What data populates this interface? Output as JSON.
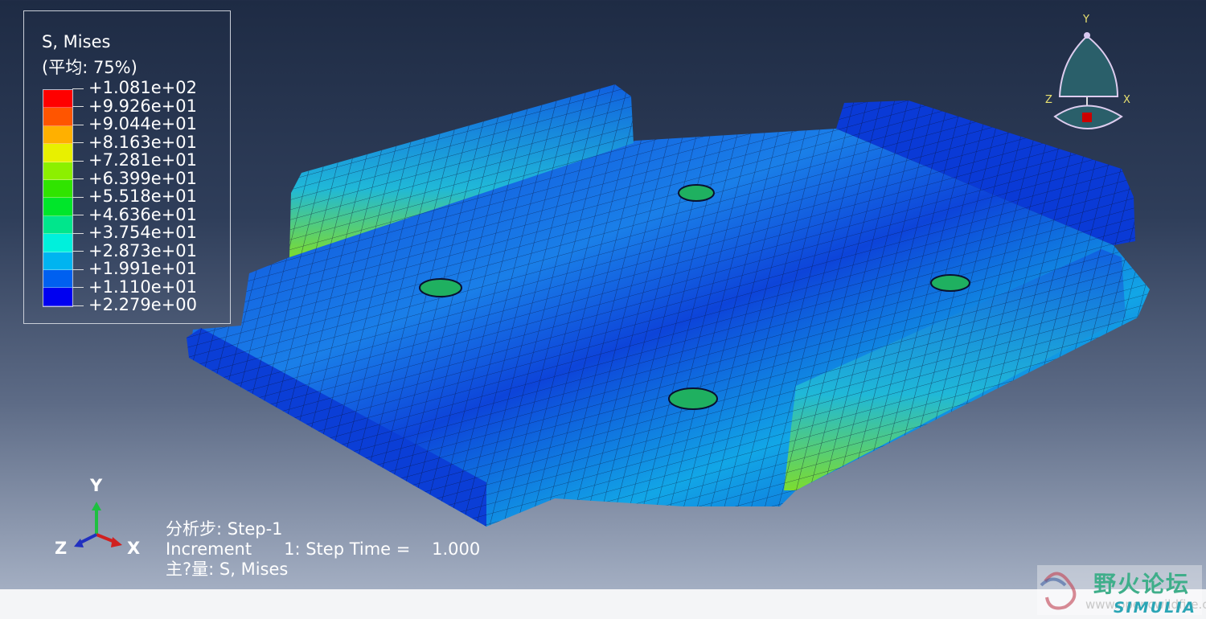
{
  "legend": {
    "title": "S, Mises",
    "subtitle": "(平均: 75%)",
    "labels": [
      "+1.081e+02",
      "+9.926e+01",
      "+9.044e+01",
      "+8.163e+01",
      "+7.281e+01",
      "+6.399e+01",
      "+5.518e+01",
      "+4.636e+01",
      "+3.754e+01",
      "+2.873e+01",
      "+1.991e+01",
      "+1.110e+01",
      "+2.279e+00"
    ],
    "band_colors": [
      "#ff0000",
      "#ff5500",
      "#ffb000",
      "#e8f000",
      "#8cf000",
      "#30e400",
      "#00e62a",
      "#00e68c",
      "#00f0dc",
      "#00b4f0",
      "#0060f0",
      "#0000f0"
    ]
  },
  "step_info": {
    "line1": "分析步: Step-1",
    "line2": "Increment      1: Step Time =    1.000",
    "line3": "主?量: S, Mises"
  },
  "triad": {
    "y": "Y",
    "z": "Z",
    "x": "X"
  },
  "view_cube": {
    "y": "Y",
    "z": "Z",
    "x": "X"
  },
  "watermark": {
    "cn": "野火论坛",
    "url": "www.opencwildfire.cn",
    "brand": "SIMULIA"
  }
}
